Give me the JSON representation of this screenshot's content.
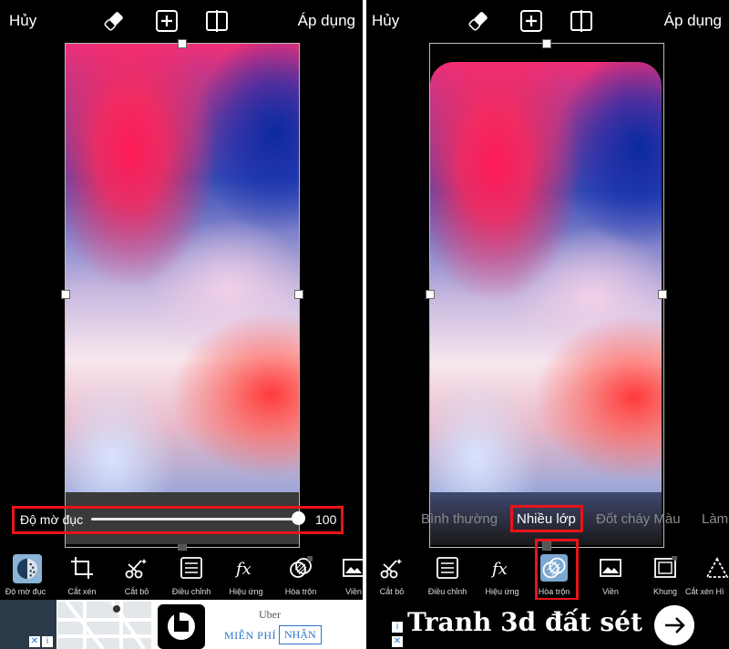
{
  "left_panel": {
    "top_bar": {
      "cancel": "Hủy",
      "apply": "Áp dụng",
      "icons": [
        "eraser-icon",
        "add-icon",
        "compare-icon"
      ]
    },
    "opacity_slider": {
      "label": "Độ mờ đục",
      "value_text": "100",
      "value": 1.0
    },
    "toolbar": [
      {
        "label": "Độ mờ đục",
        "icon": "opacity-icon",
        "selected": true
      },
      {
        "label": "Cắt xén",
        "icon": "crop-icon"
      },
      {
        "label": "Cắt bỏ",
        "icon": "cutout-icon"
      },
      {
        "label": "Điều chỉnh",
        "icon": "adjust-icon"
      },
      {
        "label": "Hiệu ứng",
        "icon": "fx-icon"
      },
      {
        "label": "Hòa trộn",
        "icon": "blend-icon"
      },
      {
        "label": "Viền",
        "icon": "border-icon"
      }
    ],
    "ad": {
      "brand": "Uber",
      "free": "MIỄN PHÍ",
      "claim": "NHẬN"
    }
  },
  "right_panel": {
    "top_bar": {
      "cancel": "Hủy",
      "apply": "Áp dụng",
      "icons": [
        "eraser-icon",
        "add-icon",
        "compare-icon"
      ]
    },
    "blend_modes": [
      "Bình thường",
      "Nhiều lớp",
      "Đốt cháy Màu",
      "Làm"
    ],
    "selected_blend": "Nhiều lớp",
    "toolbar": [
      {
        "label": "Cắt bỏ",
        "icon": "cutout-icon"
      },
      {
        "label": "Điều chỉnh",
        "icon": "adjust-icon"
      },
      {
        "label": "Hiệu ứng",
        "icon": "fx-icon"
      },
      {
        "label": "Hòa trộn",
        "icon": "blend-icon",
        "selected": true
      },
      {
        "label": "Viền",
        "icon": "border-icon"
      },
      {
        "label": "Khung",
        "icon": "frame-icon"
      },
      {
        "label": "Cắt xén Hì",
        "icon": "shape-crop-icon"
      }
    ],
    "ad": {
      "text": "Tranh 3d đất sét"
    }
  },
  "colors": {
    "highlight": "#e8141a",
    "background": "#000000"
  }
}
